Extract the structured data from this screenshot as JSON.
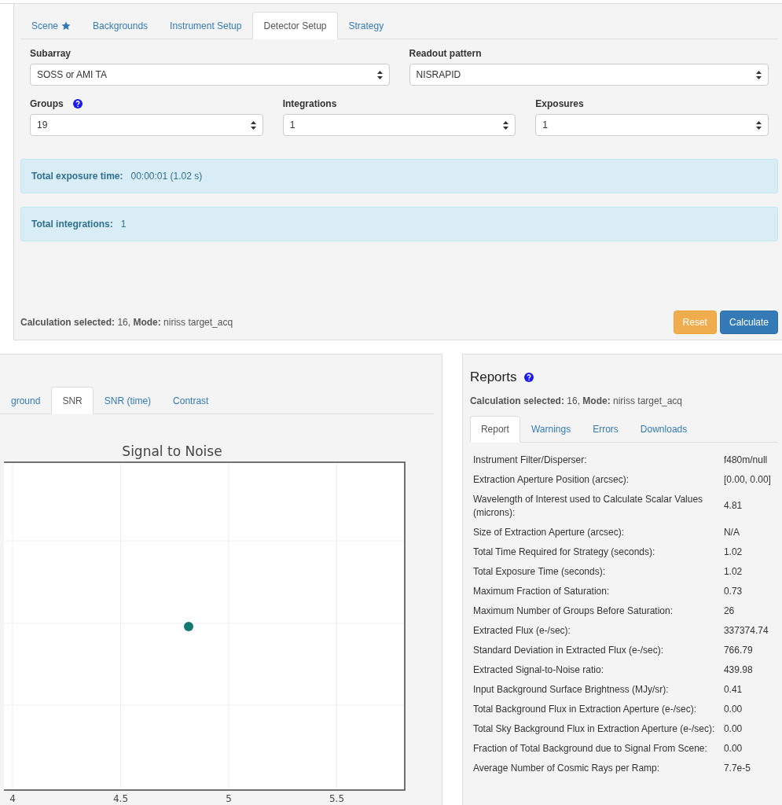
{
  "top_tabs": [
    {
      "label": "Scene",
      "star": true,
      "selected": false
    },
    {
      "label": "Backgrounds",
      "star": false,
      "selected": false
    },
    {
      "label": "Instrument Setup",
      "star": false,
      "selected": false
    },
    {
      "label": "Detector Setup",
      "star": false,
      "selected": true
    },
    {
      "label": "Strategy",
      "star": false,
      "selected": false
    }
  ],
  "field_rows": [
    [
      {
        "label": "Subarray",
        "help": false,
        "value": "SOSS or AMI TA"
      },
      {
        "label": "Readout pattern",
        "help": false,
        "value": "NISRAPID"
      }
    ],
    [
      {
        "label": "Groups",
        "help": true,
        "value": "19"
      },
      {
        "label": "Integrations",
        "help": false,
        "value": "1"
      },
      {
        "label": "Exposures",
        "help": false,
        "value": "1"
      }
    ]
  ],
  "info_boxes": [
    {
      "label": "Total exposure time:",
      "value": "00:00:01 (1.02 s)"
    },
    {
      "label": "Total integrations:",
      "value": "1"
    }
  ],
  "footer_text": "**Calculation selected:** 16, **Mode:** niriss target_acq",
  "buttons": [
    {
      "label": "Reset",
      "kind": "warning"
    },
    {
      "label": "Calculate",
      "kind": "primary"
    }
  ],
  "plot_panel": {
    "tabs": [
      {
        "label": "ground",
        "selected": false
      },
      {
        "label": "SNR",
        "selected": true
      },
      {
        "label": "SNR (time)",
        "selected": false
      },
      {
        "label": "Contrast",
        "selected": false
      }
    ],
    "plot": {
      "title": "Signal to Noise",
      "x_tick_labels": [
        "4",
        "4.5",
        "5",
        "5.5"
      ]
    }
  },
  "reports": {
    "title": "Reports",
    "help": true,
    "subtitle": "**Calculation selected:** 16, **Mode:** niriss target_acq",
    "tabs": [
      {
        "label": "Report",
        "selected": true
      },
      {
        "label": "Warnings",
        "selected": false
      },
      {
        "label": "Errors",
        "selected": false
      },
      {
        "label": "Downloads",
        "selected": false
      }
    ],
    "rows": [
      {
        "label": "Instrument Filter/Disperser:",
        "value": "f480m/null"
      },
      {
        "label": "Extraction Aperture Position (arcsec):",
        "value": "[0.00, 0.00]"
      },
      {
        "label": "Wavelength of Interest used to Calculate Scalar Values (microns):",
        "value": "4.81"
      },
      {
        "label": "Size of Extraction Aperture (arcsec):",
        "value": "N/A"
      },
      {
        "label": "Total Time Required for Strategy (seconds):",
        "value": "1.02"
      },
      {
        "label": "Total Exposure Time (seconds):",
        "value": "1.02"
      },
      {
        "label": "Maximum Fraction of Saturation:",
        "value": "0.73"
      },
      {
        "label": "Maximum Number of Groups Before Saturation:",
        "value": "26"
      },
      {
        "label": "Extracted Flux (e-/sec):",
        "value": "337374.74"
      },
      {
        "label": "Standard Deviation in Extracted Flux (e-/sec):",
        "value": "766.79"
      },
      {
        "label": "Extracted Signal-to-Noise ratio:",
        "value": "439.98"
      },
      {
        "label": "Input Background Surface Brightness (MJy/sr):",
        "value": "0.41"
      },
      {
        "label": "Total Background Flux in Extraction Aperture (e-/sec):",
        "value": "0.00"
      },
      {
        "label": "Total Sky Background Flux in Extraction Aperture (e-/sec):",
        "value": "0.00"
      },
      {
        "label": "Fraction of Total Background due to Signal From Scene:",
        "value": "0.00"
      },
      {
        "label": "Average Number of Cosmic Rays per Ramp:",
        "value": "7.7e-5"
      }
    ]
  }
}
